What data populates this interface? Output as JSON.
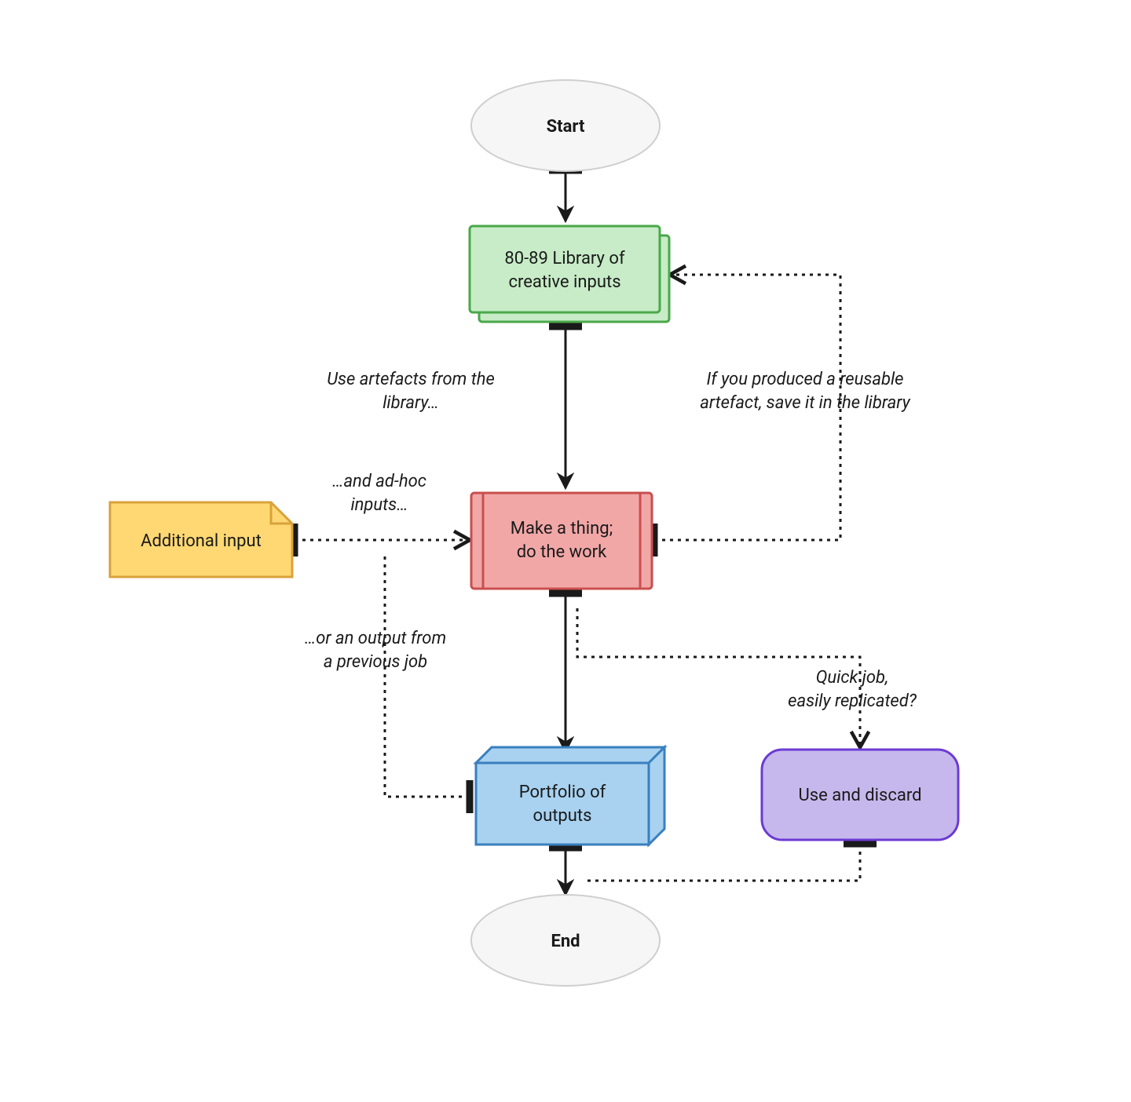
{
  "nodes": {
    "start": {
      "label": "Start"
    },
    "library": {
      "label1": "80-89 Library of",
      "label2": "creative inputs"
    },
    "additional_input": {
      "label": "Additional input"
    },
    "make": {
      "label1": "Make a thing;",
      "label2": "do the work"
    },
    "portfolio": {
      "label1": "Portfolio of",
      "label2": "outputs"
    },
    "use_discard": {
      "label": "Use and discard"
    },
    "end": {
      "label": "End"
    }
  },
  "edges": {
    "library_to_make": {
      "l1": "Use artefacts from the",
      "l2": "library…"
    },
    "additional_to_make": {
      "l1": "…and ad-hoc",
      "l2": "inputs…"
    },
    "portfolio_back": {
      "l1": "…or an output from",
      "l2": "a previous job"
    },
    "make_to_library": {
      "l1": "If you produced a reusable",
      "l2": "artefact, save it in the library"
    },
    "make_to_discard": {
      "l1": "Quick job,",
      "l2": "easily replicated?"
    }
  },
  "colors": {
    "start_fill": "#f6f6f6",
    "start_stroke": "#cfcfcf",
    "library_fill": "#c7ecc7",
    "library_stroke": "#4aa84a",
    "additional_fill": "#ffd873",
    "additional_stroke": "#d9a23b",
    "make_fill": "#f2a7a7",
    "make_stroke": "#c94f4f",
    "portfolio_fill": "#a8d2f0",
    "portfolio_stroke": "#3a7fbf",
    "discard_fill": "#c6b8ec",
    "discard_stroke": "#6b3bd4",
    "arrow": "#1a1a1a"
  }
}
